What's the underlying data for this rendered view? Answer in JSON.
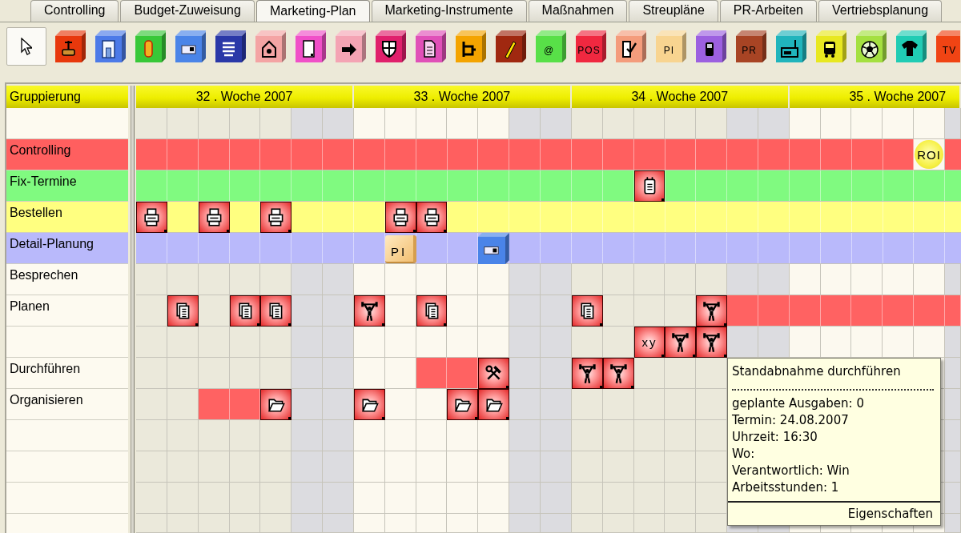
{
  "tabs": [
    {
      "label": "Controlling",
      "selected": false
    },
    {
      "label": "Budget-Zuweisung",
      "selected": false
    },
    {
      "label": "Marketing-Plan",
      "selected": true
    },
    {
      "label": "Marketing-Instrumente",
      "selected": false
    },
    {
      "label": "Maßnahmen",
      "selected": false
    },
    {
      "label": "Streupläne",
      "selected": false
    },
    {
      "label": "PR-Arbeiten",
      "selected": false
    },
    {
      "label": "Vertriebsplanung",
      "selected": false
    }
  ],
  "toolbar": [
    {
      "kind": "pointer",
      "selected": true
    },
    {
      "kind": "plunger",
      "color": "#e8380c",
      "selected": false
    },
    {
      "kind": "door",
      "color": "#4c7ae8",
      "selected": false
    },
    {
      "kind": "cylinder",
      "color": "#38c838",
      "selected": false
    },
    {
      "kind": "card",
      "color": "#4a84e8",
      "selected": false
    },
    {
      "kind": "list",
      "color": "#2a38a8",
      "selected": false
    },
    {
      "kind": "house",
      "color": "#f4a4a4",
      "selected": false
    },
    {
      "kind": "page",
      "color": "#f050c8",
      "selected": false
    },
    {
      "kind": "arrow",
      "color": "#f4a4b4",
      "selected": false
    },
    {
      "kind": "shield",
      "color": "#e0206c",
      "selected": false
    },
    {
      "kind": "document",
      "color": "#e050b8",
      "selected": false
    },
    {
      "kind": "bracket",
      "color": "#f4a400",
      "selected": false
    },
    {
      "kind": "pen",
      "color": "#a02810",
      "selected": false
    },
    {
      "kind": "label",
      "label": "@",
      "color": "#58e048",
      "selected": false
    },
    {
      "kind": "label",
      "label": "POS",
      "color": "#f02840",
      "selected": false
    },
    {
      "kind": "check",
      "color": "#f49c7c",
      "selected": false
    },
    {
      "kind": "label",
      "label": "PI",
      "color": "#f8d490",
      "selected": false
    },
    {
      "kind": "phone",
      "color": "#9c60e0",
      "selected": false
    },
    {
      "kind": "label",
      "label": "PR",
      "color": "#a84424",
      "selected": false
    },
    {
      "kind": "radio",
      "color": "#20b4bc",
      "selected": false
    },
    {
      "kind": "bus",
      "color": "#e8e820",
      "selected": false
    },
    {
      "kind": "ball",
      "color": "#a4e040",
      "selected": false
    },
    {
      "kind": "shirt",
      "color": "#20ccb4",
      "selected": false
    },
    {
      "kind": "label",
      "label": "TV",
      "color": "#f04414",
      "selected": false
    }
  ],
  "grid": {
    "group_header": "Gruppierung",
    "weeks": [
      {
        "label": "32 . Woche 2007",
        "days": [
          {
            "weekend": false
          },
          {
            "weekend": false
          },
          {
            "weekend": false
          },
          {
            "weekend": false
          },
          {
            "weekend": false
          },
          {
            "weekend": true
          },
          {
            "weekend": true
          }
        ]
      },
      {
        "label": "33 . Woche 2007",
        "days": [
          {
            "weekend": false
          },
          {
            "weekend": false
          },
          {
            "weekend": false
          },
          {
            "weekend": false
          },
          {
            "weekend": false
          },
          {
            "weekend": true
          },
          {
            "weekend": true
          }
        ]
      },
      {
        "label": "34 . Woche 2007",
        "days": [
          {
            "weekend": false
          },
          {
            "weekend": false
          },
          {
            "weekend": false
          },
          {
            "weekend": false
          },
          {
            "weekend": false
          },
          {
            "weekend": true
          },
          {
            "weekend": true
          }
        ]
      },
      {
        "label": "35 . Woche 2007",
        "days": [
          {
            "weekend": false
          },
          {
            "weekend": false
          },
          {
            "weekend": false
          },
          {
            "weekend": false
          },
          {
            "weekend": false
          },
          {
            "weekend": true
          }
        ]
      }
    ],
    "rows": [
      {},
      {
        "label": "Controlling",
        "color": "#ff5f5f",
        "cells": [
          {
            "kind": "free"
          },
          {
            "kind": "free"
          },
          {
            "kind": "free"
          },
          {
            "kind": "free"
          },
          {
            "kind": "free"
          },
          {
            "kind": "free"
          },
          {
            "kind": "free"
          },
          {
            "kind": "free"
          },
          {
            "kind": "free"
          },
          {
            "kind": "free"
          },
          {
            "kind": "free"
          },
          {
            "kind": "free"
          },
          {
            "kind": "free"
          },
          {
            "kind": "free"
          },
          {
            "kind": "free"
          },
          {
            "kind": "free"
          },
          {
            "kind": "free"
          },
          {
            "kind": "free"
          },
          {
            "kind": "free"
          },
          {
            "kind": "free"
          },
          {
            "kind": "free"
          },
          {
            "kind": "free"
          },
          {
            "kind": "free"
          },
          {
            "kind": "free"
          },
          {
            "kind": "free"
          },
          {
            "kind": "milestone",
            "label": "ROI"
          }
        ]
      },
      {
        "label": "Fix-Termine",
        "color": "#80fa80",
        "cells": [
          {
            "kind": "free"
          },
          {
            "kind": "free"
          },
          {
            "kind": "free"
          },
          {
            "kind": "free"
          },
          {
            "kind": "free"
          },
          {
            "kind": "free"
          },
          {
            "kind": "free"
          },
          {
            "kind": "free"
          },
          {
            "kind": "free"
          },
          {
            "kind": "free"
          },
          {
            "kind": "free"
          },
          {
            "kind": "free"
          },
          {
            "kind": "free"
          },
          {
            "kind": "free"
          },
          {
            "kind": "free"
          },
          {
            "kind": "free"
          },
          {
            "kind": "calendar"
          }
        ]
      },
      {
        "label": "Bestellen",
        "color": "#ffff80",
        "cells": [
          {
            "kind": "printer"
          },
          {
            "kind": "free"
          },
          {
            "kind": "printer"
          },
          {
            "kind": "free"
          },
          {
            "kind": "printer"
          },
          {
            "kind": "free"
          },
          {
            "kind": "free"
          },
          {
            "kind": "free"
          },
          {
            "kind": "printer"
          },
          {
            "kind": "printer"
          }
        ]
      },
      {
        "label": "Detail-Planung",
        "color": "#b9b9fb",
        "cells": [
          {
            "kind": "free"
          },
          {
            "kind": "free"
          },
          {
            "kind": "free"
          },
          {
            "kind": "free"
          },
          {
            "kind": "free"
          },
          {
            "kind": "free"
          },
          {
            "kind": "free"
          },
          {
            "kind": "free"
          },
          {
            "kind": "note",
            "label": "PI"
          },
          {
            "kind": "free"
          },
          {
            "kind": "free"
          },
          {
            "kind": "card"
          }
        ]
      },
      {
        "label": "Besprechen"
      },
      {
        "label": "Planen",
        "cells": [
          {
            "kind": "free"
          },
          {
            "kind": "documents"
          },
          {
            "kind": "free"
          },
          {
            "kind": "documents"
          },
          {
            "kind": "documents"
          },
          {
            "kind": "free"
          },
          {
            "kind": "free"
          },
          {
            "kind": "lifter"
          },
          {
            "kind": "free"
          },
          {
            "kind": "documents"
          },
          {
            "kind": "free"
          },
          {
            "kind": "free"
          },
          {
            "kind": "free"
          },
          {
            "kind": "free"
          },
          {
            "kind": "documents"
          },
          {
            "kind": "free"
          },
          {
            "kind": "free"
          },
          {
            "kind": "free"
          },
          {
            "kind": "lifter"
          },
          {
            "kind": "bar"
          },
          {
            "kind": "bar"
          },
          {
            "kind": "bar"
          },
          {
            "kind": "bar"
          },
          {
            "kind": "bar"
          },
          {
            "kind": "bar"
          },
          {
            "kind": "bar"
          },
          {
            "kind": "bar"
          }
        ]
      },
      {
        "cells": [
          {
            "kind": "free"
          },
          {
            "kind": "free"
          },
          {
            "kind": "free"
          },
          {
            "kind": "free"
          },
          {
            "kind": "free"
          },
          {
            "kind": "free"
          },
          {
            "kind": "free"
          },
          {
            "kind": "free"
          },
          {
            "kind": "free"
          },
          {
            "kind": "free"
          },
          {
            "kind": "free"
          },
          {
            "kind": "free"
          },
          {
            "kind": "free"
          },
          {
            "kind": "free"
          },
          {
            "kind": "free"
          },
          {
            "kind": "free"
          },
          {
            "kind": "text",
            "label": "xy"
          },
          {
            "kind": "lifter"
          },
          {
            "kind": "lifter"
          }
        ]
      },
      {
        "label": "Durchführen",
        "cells": [
          {
            "kind": "free"
          },
          {
            "kind": "free"
          },
          {
            "kind": "free"
          },
          {
            "kind": "free"
          },
          {
            "kind": "free"
          },
          {
            "kind": "free"
          },
          {
            "kind": "free"
          },
          {
            "kind": "free"
          },
          {
            "kind": "free"
          },
          {
            "kind": "bar"
          },
          {
            "kind": "bar"
          },
          {
            "kind": "tools"
          },
          {
            "kind": "free"
          },
          {
            "kind": "free"
          },
          {
            "kind": "lifter"
          },
          {
            "kind": "lifter"
          }
        ]
      },
      {
        "label": "Organisieren",
        "cells": [
          {
            "kind": "free"
          },
          {
            "kind": "free"
          },
          {
            "kind": "bar"
          },
          {
            "kind": "bar"
          },
          {
            "kind": "folder"
          },
          {
            "kind": "free"
          },
          {
            "kind": "free"
          },
          {
            "kind": "folder"
          },
          {
            "kind": "free"
          },
          {
            "kind": "free"
          },
          {
            "kind": "folder"
          },
          {
            "kind": "folder"
          }
        ]
      },
      {},
      {},
      {},
      {}
    ]
  },
  "tooltip": {
    "title": "Standabnahme durchführen",
    "lines": [
      "geplante Ausgaben: 0",
      "Termin: 24.08.2007",
      "Uhrzeit: 16:30",
      "Wo:",
      "Verantwortlich: Win",
      "Arbeitsstunden: 1"
    ],
    "action": "Eigenschaften"
  }
}
